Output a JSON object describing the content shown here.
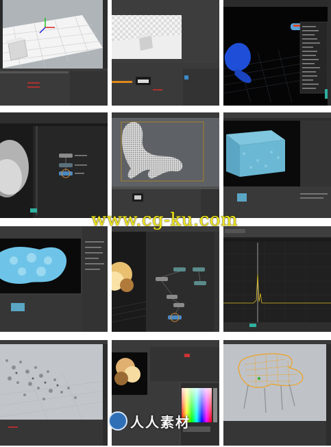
{
  "grid": {
    "cells": [
      {
        "id": "c1",
        "scene": "viewport-grid-cube"
      },
      {
        "id": "c2",
        "scene": "render-cube-checker"
      },
      {
        "id": "c3",
        "scene": "blue-object-menu"
      },
      {
        "id": "c4",
        "scene": "dark-network-nodes"
      },
      {
        "id": "c5",
        "scene": "voxel-dinosaur"
      },
      {
        "id": "c6",
        "scene": "cyan-fluid-box"
      },
      {
        "id": "c7",
        "scene": "cyan-fluid-sim"
      },
      {
        "id": "c8",
        "scene": "explosion-network"
      },
      {
        "id": "c9",
        "scene": "graph-editor"
      },
      {
        "id": "c10",
        "scene": "particle-scatter"
      },
      {
        "id": "c11",
        "scene": "explosion-color-picker"
      },
      {
        "id": "c12",
        "scene": "orange-wire-chair"
      }
    ]
  },
  "watermark": {
    "text": "www.cg-ku.com"
  },
  "logo": {
    "text": "人人素材"
  },
  "colors": {
    "ui_dark": "#3a3a3a",
    "ui_panel": "#2f2f2f",
    "viewport_sky": "#9a9a9a",
    "cyan": "#5fb4d4",
    "blue_obj": "#1f4fd8",
    "orange_wire": "#f0a020",
    "watermark": "#f2ea1c"
  }
}
